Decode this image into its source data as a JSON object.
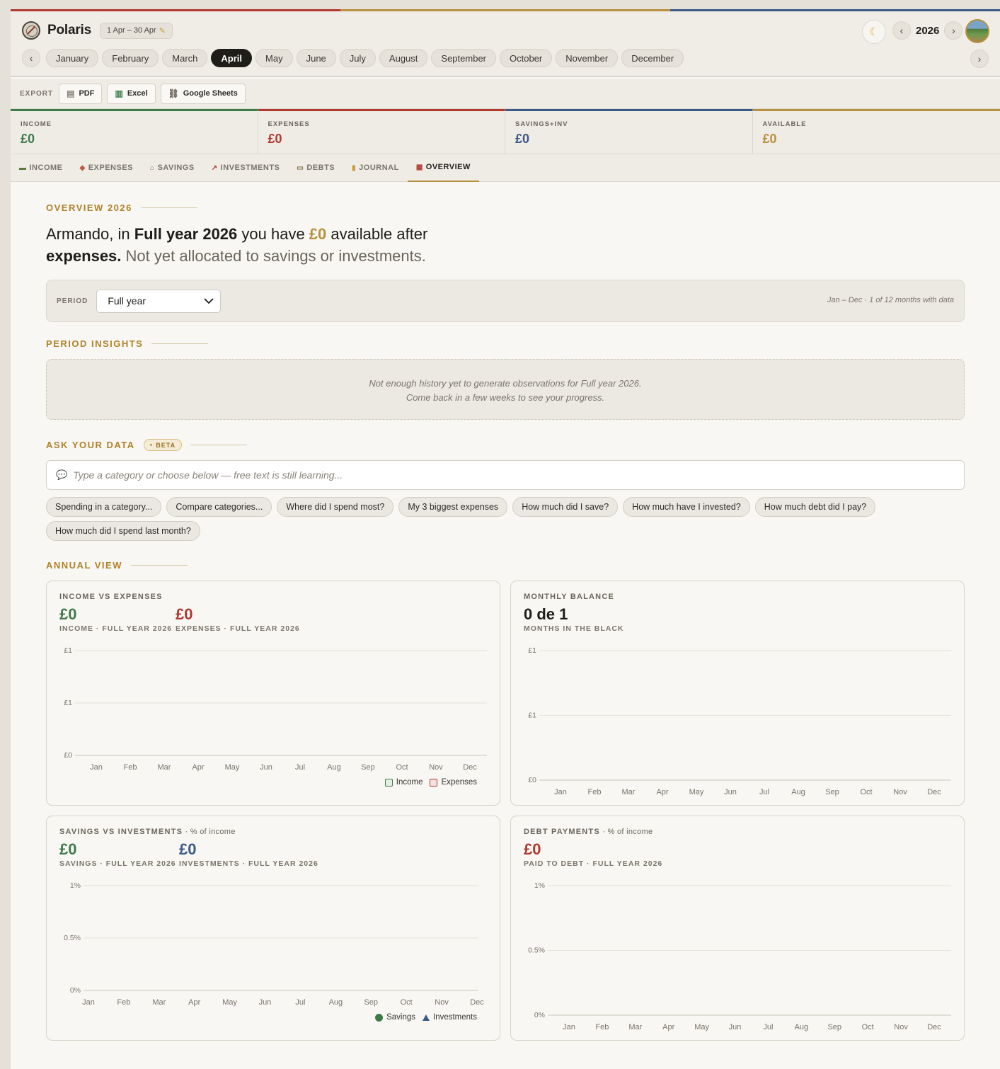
{
  "brand": {
    "name": "Polaris",
    "range": "1 Apr – 30 Apr",
    "range_icon": "pencil-icon"
  },
  "colors": {
    "income": "#3f7a4a",
    "expenses": "#b0382f",
    "savings": "#3a5a88",
    "available": "#b8913e"
  },
  "year": {
    "value": "2026",
    "prev": "‹",
    "next": "›"
  },
  "months": {
    "prev": "‹",
    "next": "›",
    "items": [
      "January",
      "February",
      "March",
      "April",
      "May",
      "June",
      "July",
      "August",
      "September",
      "October",
      "November",
      "December"
    ],
    "active": "April"
  },
  "export": {
    "label": "EXPORT",
    "buttons": [
      {
        "label": "PDF",
        "icon": "pdf-icon"
      },
      {
        "label": "Excel",
        "icon": "excel-icon"
      },
      {
        "label": "Google Sheets",
        "icon": "link-icon"
      }
    ]
  },
  "summary": [
    {
      "label": "INCOME",
      "value": "£0"
    },
    {
      "label": "EXPENSES",
      "value": "£0"
    },
    {
      "label": "SAVINGS+INV",
      "value": "£0"
    },
    {
      "label": "AVAILABLE",
      "value": "£0"
    }
  ],
  "tabs": [
    {
      "label": "INCOME",
      "icon": "cash-icon"
    },
    {
      "label": "EXPENSES",
      "icon": "wallet-icon"
    },
    {
      "label": "SAVINGS",
      "icon": "bank-icon"
    },
    {
      "label": "INVESTMENTS",
      "icon": "chart-up-icon"
    },
    {
      "label": "DEBTS",
      "icon": "card-icon"
    },
    {
      "label": "JOURNAL",
      "icon": "scroll-icon"
    },
    {
      "label": "OVERVIEW",
      "icon": "calendar-icon"
    }
  ],
  "overview": {
    "section_title": "OVERVIEW 2026",
    "headline": {
      "name": "Armando, in ",
      "period": "Full year 2026",
      "mid": " you have ",
      "amount": "£0",
      "after": " available after ",
      "bold_end": "expenses.",
      "muted": " Not yet allocated to savings or investments."
    },
    "period": {
      "label": "PERIOD",
      "selected": "Full year",
      "meta": "Jan – Dec · 1 of 12 months with data"
    }
  },
  "insights": {
    "title": "PERIOD INSIGHTS",
    "line1": "Not enough history yet to generate observations for Full year 2026.",
    "line2": "Come back in a few weeks to see your progress."
  },
  "ask": {
    "title": "ASK YOUR DATA",
    "badge": "BETA",
    "placeholder": "Type a category or choose below — free text is still learning...",
    "chips": [
      "Spending in a category...",
      "Compare categories...",
      "Where did I spend most?",
      "My 3 biggest expenses",
      "How much did I save?",
      "How much have I invested?",
      "How much debt did I pay?",
      "How much did I spend last month?"
    ]
  },
  "annual": {
    "title": "ANNUAL VIEW",
    "panels": {
      "income_expenses": {
        "title": "INCOME VS EXPENSES",
        "stats": [
          {
            "value": "£0",
            "label": "INCOME · FULL YEAR 2026"
          },
          {
            "value": "£0",
            "label": "EXPENSES · FULL YEAR 2026"
          }
        ],
        "legend": [
          "Income",
          "Expenses"
        ]
      },
      "monthly_balance": {
        "title": "MONTHLY BALANCE",
        "stats": [
          {
            "value": "0 de 1",
            "label": "MONTHS IN THE BLACK"
          }
        ]
      },
      "savings_investments": {
        "title": "SAVINGS VS INVESTMENTS",
        "subtitle": " · % of income",
        "stats": [
          {
            "value": "£0",
            "label": "SAVINGS · FULL YEAR 2026"
          },
          {
            "value": "£0",
            "label": "INVESTMENTS · FULL YEAR 2026"
          }
        ],
        "legend": [
          "Savings",
          "Investments"
        ]
      },
      "debt": {
        "title": "DEBT PAYMENTS",
        "subtitle": " · % of income",
        "stats": [
          {
            "value": "£0",
            "label": "PAID TO DEBT · FULL YEAR 2026"
          }
        ]
      }
    }
  },
  "chart_data": [
    {
      "type": "bar",
      "categories": [
        "Jan",
        "Feb",
        "Mar",
        "Apr",
        "May",
        "Jun",
        "Jul",
        "Aug",
        "Sep",
        "Oct",
        "Nov",
        "Dec"
      ],
      "yticks": [
        "£1",
        "£1",
        "£0"
      ],
      "series": [
        {
          "name": "Income",
          "values": [
            0,
            0,
            0,
            0,
            0,
            0,
            0,
            0,
            0,
            0,
            0,
            0
          ]
        },
        {
          "name": "Expenses",
          "values": [
            0,
            0,
            0,
            0,
            0,
            0,
            0,
            0,
            0,
            0,
            0,
            0
          ]
        }
      ]
    },
    {
      "type": "bar",
      "categories": [
        "Jan",
        "Feb",
        "Mar",
        "Apr",
        "May",
        "Jun",
        "Jul",
        "Aug",
        "Sep",
        "Oct",
        "Nov",
        "Dec"
      ],
      "yticks": [
        "£1",
        "£1",
        "£0"
      ],
      "series": [
        {
          "values": [
            0,
            0,
            0,
            0,
            0,
            0,
            0,
            0,
            0,
            0,
            0,
            0
          ]
        }
      ]
    },
    {
      "type": "line",
      "categories": [
        "Jan",
        "Feb",
        "Mar",
        "Apr",
        "May",
        "Jun",
        "Jul",
        "Aug",
        "Sep",
        "Oct",
        "Nov",
        "Dec"
      ],
      "yticks": [
        "1%",
        "0.5%",
        "0%"
      ],
      "series": [
        {
          "name": "Savings",
          "values": [
            0,
            0,
            0,
            0,
            0,
            0,
            0,
            0,
            0,
            0,
            0,
            0
          ]
        },
        {
          "name": "Investments",
          "values": [
            0,
            0,
            0,
            0,
            0,
            0,
            0,
            0,
            0,
            0,
            0,
            0
          ]
        }
      ]
    },
    {
      "type": "bar",
      "categories": [
        "Jan",
        "Feb",
        "Mar",
        "Apr",
        "May",
        "Jun",
        "Jul",
        "Aug",
        "Sep",
        "Oct",
        "Nov",
        "Dec"
      ],
      "yticks": [
        "1%",
        "0.5%",
        "0%"
      ],
      "series": [
        {
          "values": [
            0,
            0,
            0,
            0,
            0,
            0,
            0,
            0,
            0,
            0,
            0,
            0
          ]
        }
      ]
    }
  ]
}
